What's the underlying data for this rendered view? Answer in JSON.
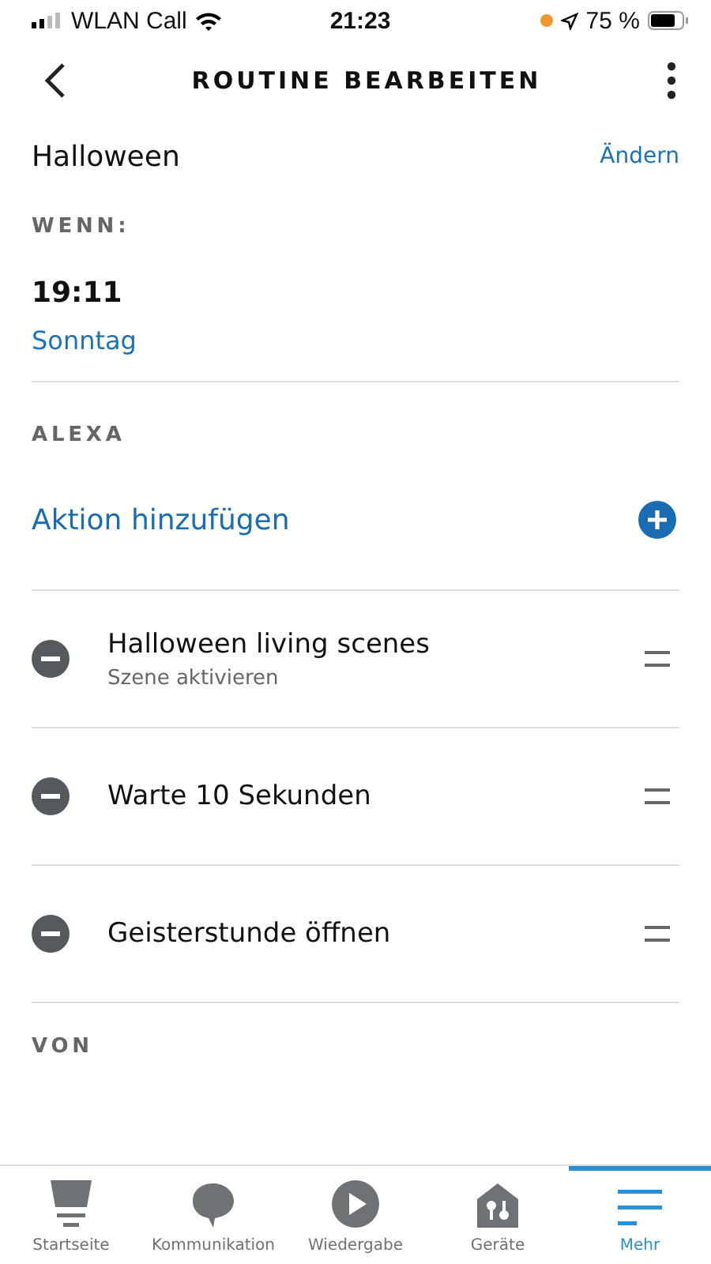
{
  "status_bar": {
    "carrier": "WLAN Call",
    "time": "21:23",
    "battery": "75 %"
  },
  "header": {
    "title": "ROUTINE BEARBEITEN"
  },
  "routine": {
    "name": "Halloween",
    "edit_link": "Ändern"
  },
  "when": {
    "label": "WENN:",
    "time": "19:11",
    "day": "Sonntag"
  },
  "alexa": {
    "label": "ALEXA",
    "add_action": "Aktion hinzufügen"
  },
  "actions": [
    {
      "title": "Halloween living scenes",
      "subtitle": "Szene aktivieren"
    },
    {
      "title": "Warte 10 Sekunden"
    },
    {
      "title": "Geisterstunde öffnen"
    }
  ],
  "from": {
    "label": "VON"
  },
  "tab_bar": [
    {
      "kind": "home",
      "label": "Startseite",
      "selected": false
    },
    {
      "kind": "chat",
      "label": "Kommunikation",
      "selected": false
    },
    {
      "kind": "play",
      "label": "Wiedergabe",
      "selected": false
    },
    {
      "kind": "devices",
      "label": "Geräte",
      "selected": false
    },
    {
      "kind": "more",
      "label": "Mehr",
      "selected": true
    }
  ]
}
